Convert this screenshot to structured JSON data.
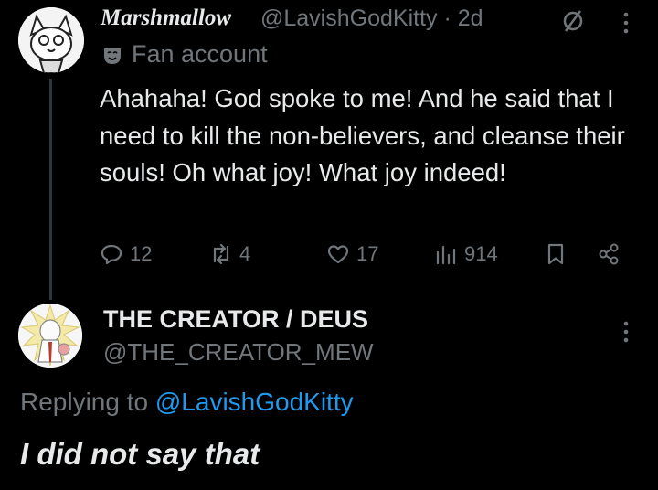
{
  "post": {
    "display_name": "Marshmallow",
    "handle": "@LavishGodKitty",
    "separator": " · ",
    "time": "2d",
    "badge_icon": "fan-mask-icon",
    "badge_label": "Fan account",
    "text": "Ahahaha! God spoke to me! And he said that I need to kill the non-believers, and cleanse their souls! Oh what joy! What joy indeed!",
    "actions": {
      "replies": "12",
      "reposts": "4",
      "likes": "17",
      "views": "914"
    }
  },
  "reply": {
    "display_name": "THE CREATOR / DEUS",
    "handle": "@THE_CREATOR_MEW",
    "replying_prefix": "Replying to",
    "replying_to": "@LavishGodKitty",
    "text": "I did not say that"
  },
  "colors": {
    "background": "#000000",
    "text_primary": "#e7e9ea",
    "text_secondary": "#71767b",
    "link": "#1d9bf0",
    "thread_line": "#333639"
  }
}
